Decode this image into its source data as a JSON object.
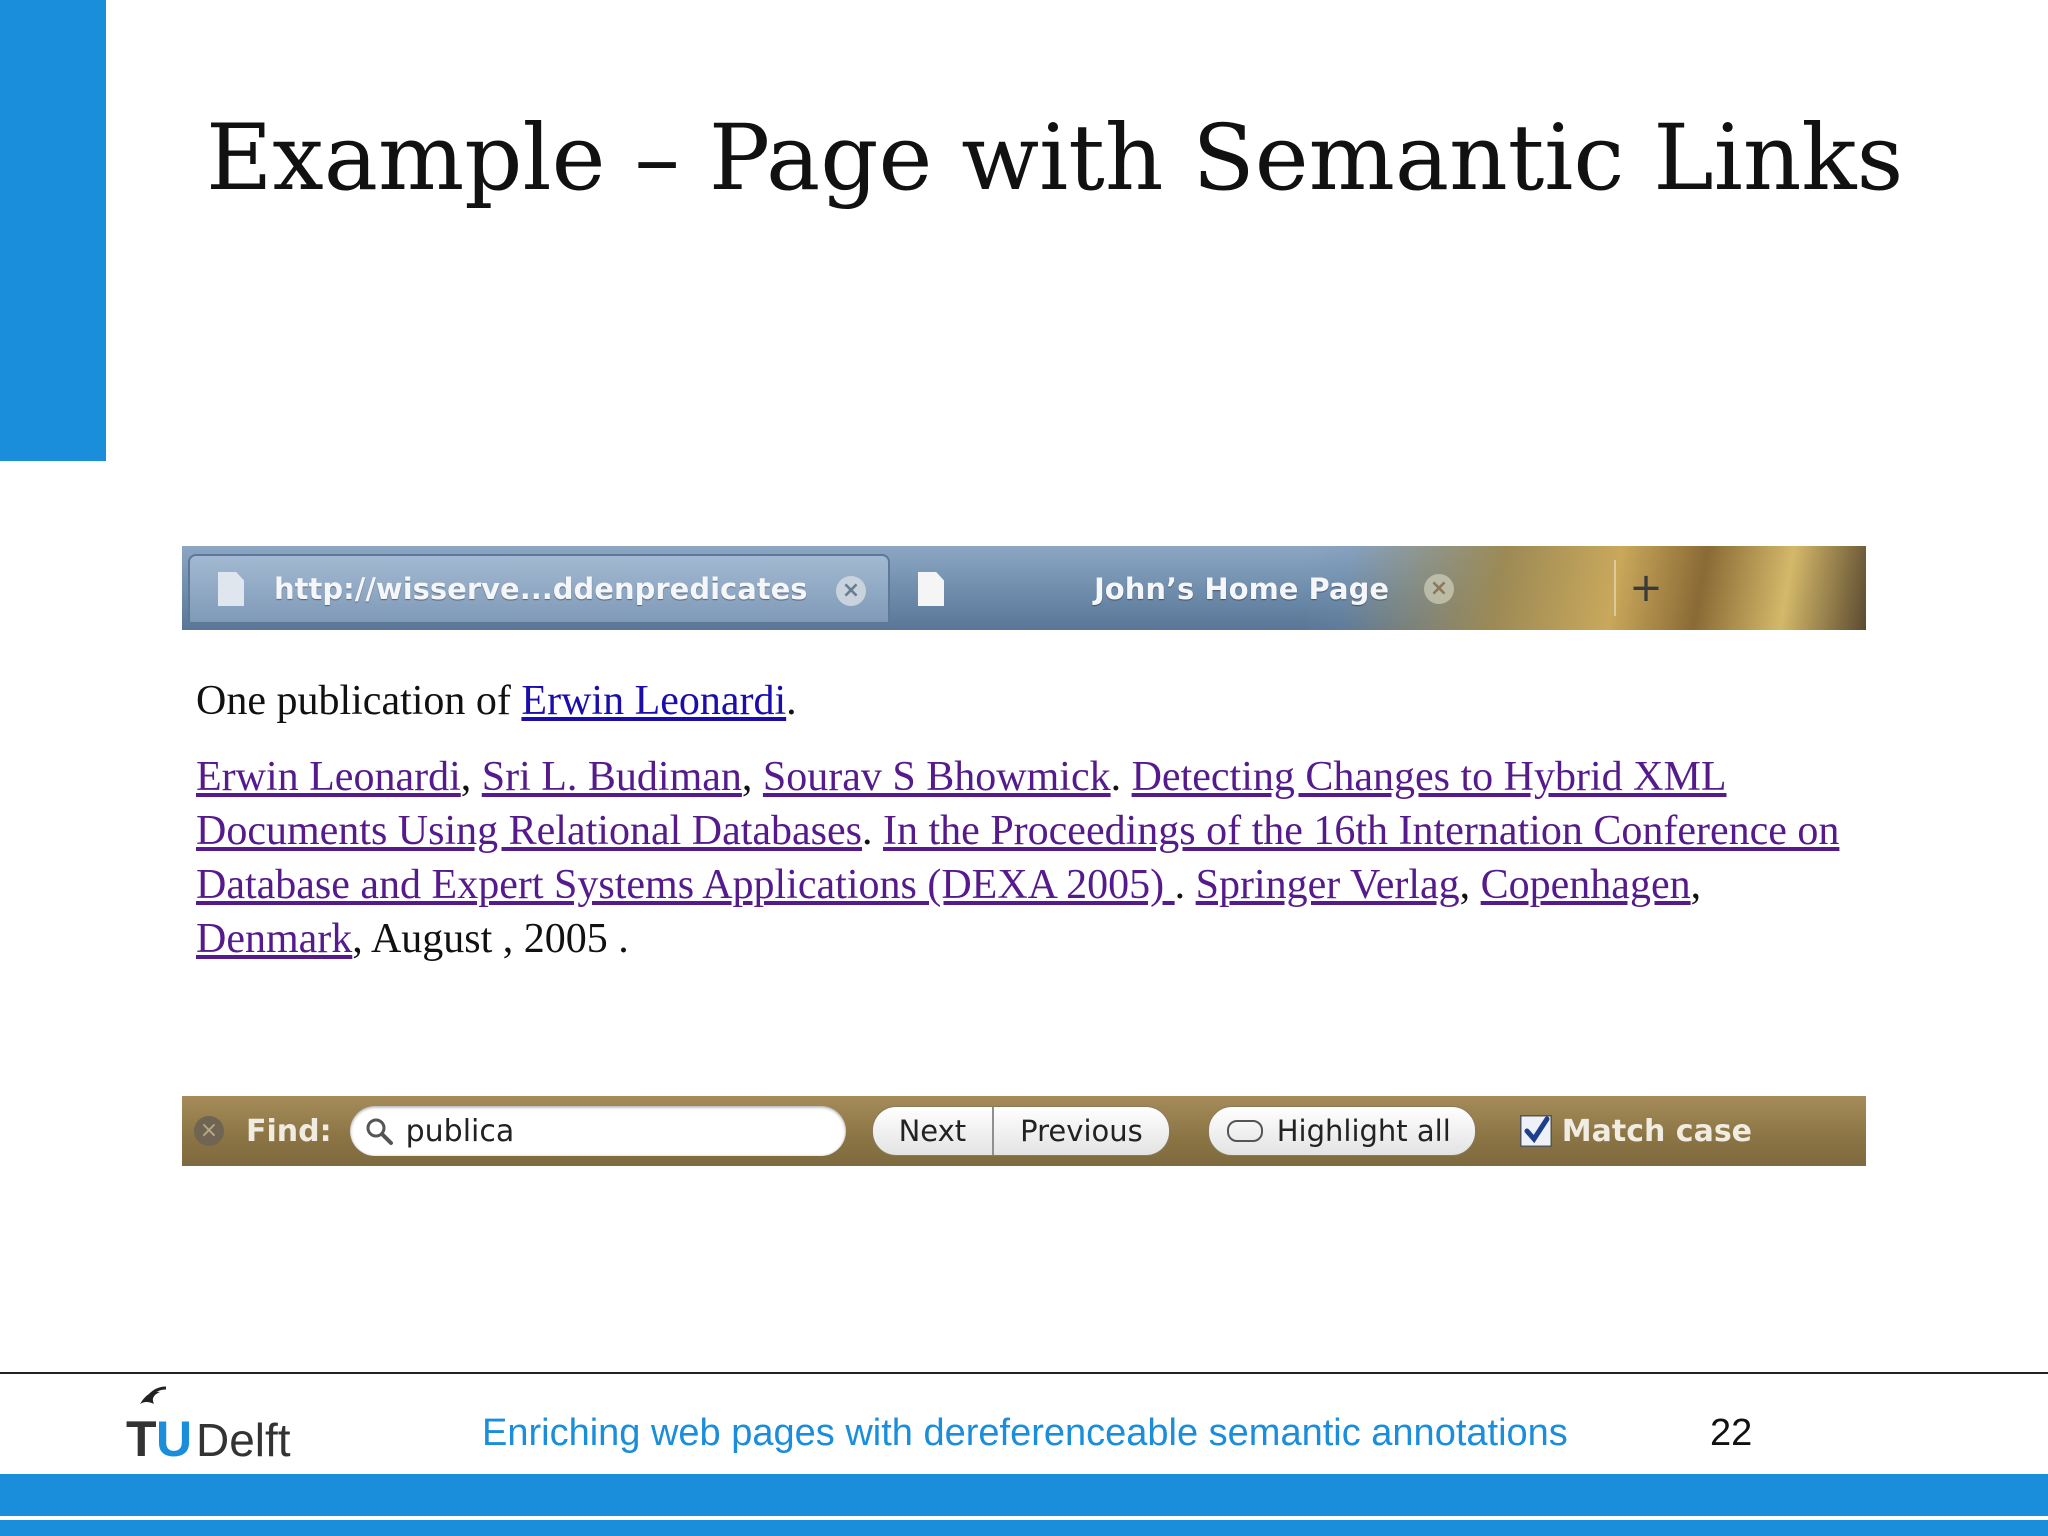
{
  "slide": {
    "title": "Example – Page with Semantic Links",
    "footer_text": "Enriching web pages with dereferenceable semantic annotations",
    "page_number": "22",
    "logo": {
      "tu": "TU",
      "delft": "Delft"
    },
    "accent_color": "#1a8ddb"
  },
  "browser": {
    "tabs": [
      {
        "label": "http://wisserve...ddenpredicates",
        "icon": "document-icon",
        "active": false
      },
      {
        "label": "John’s Home Page",
        "icon": "document-icon",
        "active": true
      }
    ],
    "new_tab_label": "+",
    "close_glyph": "×"
  },
  "page": {
    "intro_text": "One publication of ",
    "intro_link": "Erwin Leonardi",
    "intro_end": ".",
    "authors": [
      "Erwin Leonardi",
      "Sri L. Budiman",
      "Sourav S Bhowmick"
    ],
    "sep_comma": ", ",
    "sep_period": ". ",
    "title_link": "Detecting Changes to Hybrid XML Documents Using Relational Databases",
    "venue_link": "In the Proceedings of the 16th Internation Conference on Database and Expert Systems Applications (DEXA 2005) ",
    "sep_space_period": " . ",
    "publisher_link": "Springer Verlag",
    "city_link": "Copenhagen",
    "country_link": "Denmark",
    "date_text": ", August , 2005 ."
  },
  "findbar": {
    "close_glyph": "×",
    "label": "Find:",
    "query": "publica",
    "next_label": "Next",
    "previous_label": "Previous",
    "highlight_label": "Highlight all",
    "match_case_label": "Match case",
    "match_case_checked": true
  }
}
